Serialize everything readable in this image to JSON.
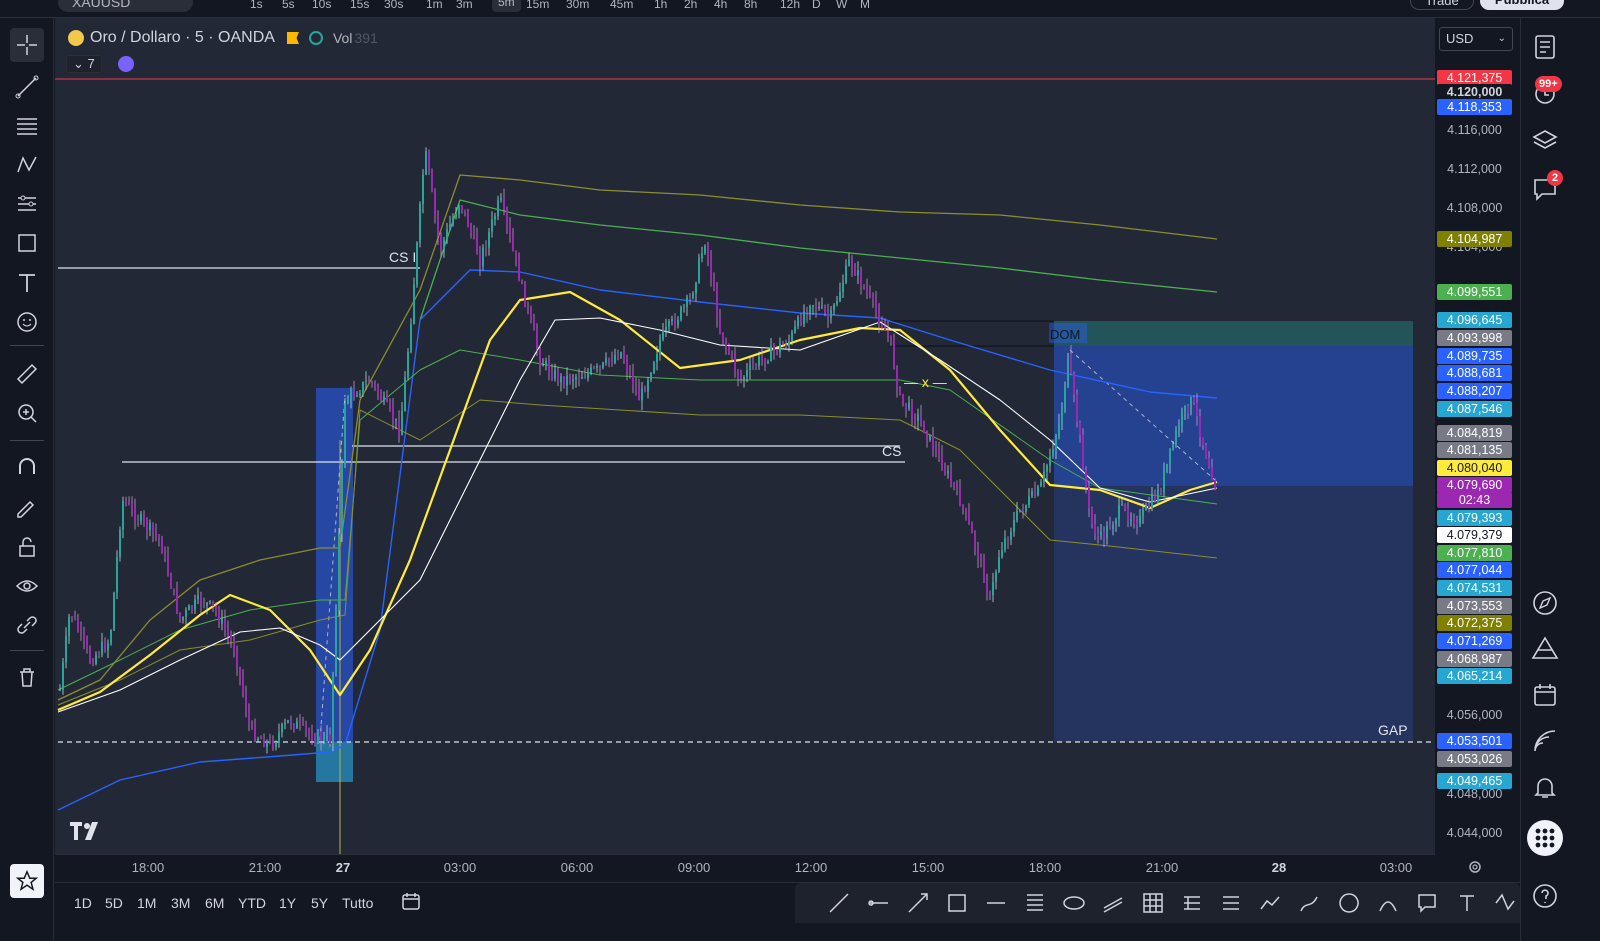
{
  "topbar": {
    "symbol": "XAUUSD",
    "timeframes": [
      "1s",
      "5s",
      "10s",
      "15s",
      "30s",
      "1m",
      "3m",
      "5m",
      "15m",
      "30m",
      "45m",
      "1h",
      "2h",
      "4h",
      "8h",
      "12h",
      "D",
      "W",
      "M"
    ],
    "active_timeframe": "5m",
    "trade_label": "Trade",
    "publish_label": "Pubblica"
  },
  "legend": {
    "title": "Oro / Dollaro · 5 · OANDA",
    "vol_label": "Vol",
    "vol_value": "391",
    "indicators_count": "7"
  },
  "currency": "USD",
  "price_ticks": [
    "4.116,000",
    "4.112,000",
    "4.108,000",
    "4.104,000",
    "4.056,000",
    "4.048,000",
    "4.044,000"
  ],
  "price_labels": [
    {
      "text": "4.121,375",
      "color": "#f23645"
    },
    {
      "text": "4.120,000",
      "color": "#131722"
    },
    {
      "text": "4.118,353",
      "color": "#2962ff"
    },
    {
      "text": "4.104,987",
      "color": "#808000"
    },
    {
      "text": "4.099,551",
      "color": "#4caf50"
    },
    {
      "text": "4.096,645",
      "color": "#26a6d1"
    },
    {
      "text": "4.093,998",
      "color": "#787b86"
    },
    {
      "text": "4.089,735",
      "color": "#2962ff"
    },
    {
      "text": "4.088,681",
      "color": "#2962ff"
    },
    {
      "text": "4.088,207",
      "color": "#2962ff"
    },
    {
      "text": "4.087,546",
      "color": "#26a6d1"
    },
    {
      "text": "4.084,819",
      "color": "#787b86"
    },
    {
      "text": "4.081,135",
      "color": "#787b86"
    },
    {
      "text": "4.080,040",
      "color": "#ffeb3b"
    },
    {
      "text": "4.079,690",
      "color": "#9c27b0"
    },
    {
      "text": "02:43",
      "color": "#9c27b0"
    },
    {
      "text": "4.079,393",
      "color": "#26a6d1"
    },
    {
      "text": "4.079,379",
      "color": "#ffffff"
    },
    {
      "text": "4.077,810",
      "color": "#4caf50"
    },
    {
      "text": "4.077,044",
      "color": "#2962ff"
    },
    {
      "text": "4.074,531",
      "color": "#26a6d1"
    },
    {
      "text": "4.073,553",
      "color": "#787b86"
    },
    {
      "text": "4.072,375",
      "color": "#808000"
    },
    {
      "text": "4.071,269",
      "color": "#2962ff"
    },
    {
      "text": "4.068,987",
      "color": "#787b86"
    },
    {
      "text": "4.065,214",
      "color": "#26a6d1"
    },
    {
      "text": "4.053,501",
      "color": "#2962ff"
    },
    {
      "text": "4.053,026",
      "color": "#787b86"
    },
    {
      "text": "4.049,465",
      "color": "#26a6d1"
    }
  ],
  "time_labels": [
    "18:00",
    "21:00",
    "27",
    "03:00",
    "06:00",
    "09:00",
    "12:00",
    "15:00",
    "18:00",
    "21:00",
    "28",
    "03:00"
  ],
  "annotations": {
    "cs1": "CS I",
    "cs2": "CS",
    "dom": "DOM",
    "x": "— x —",
    "gap": "GAP"
  },
  "ranges": [
    "1D",
    "5D",
    "1M",
    "3M",
    "6M",
    "YTD",
    "1Y",
    "5Y",
    "Tutto"
  ],
  "badges": {
    "notifications": "99+",
    "chat": "2"
  },
  "colors": {
    "bg": "#232836",
    "panel": "#131722",
    "accent": "#2962ff",
    "up": "#26a69a",
    "down": "#9c27b0"
  }
}
